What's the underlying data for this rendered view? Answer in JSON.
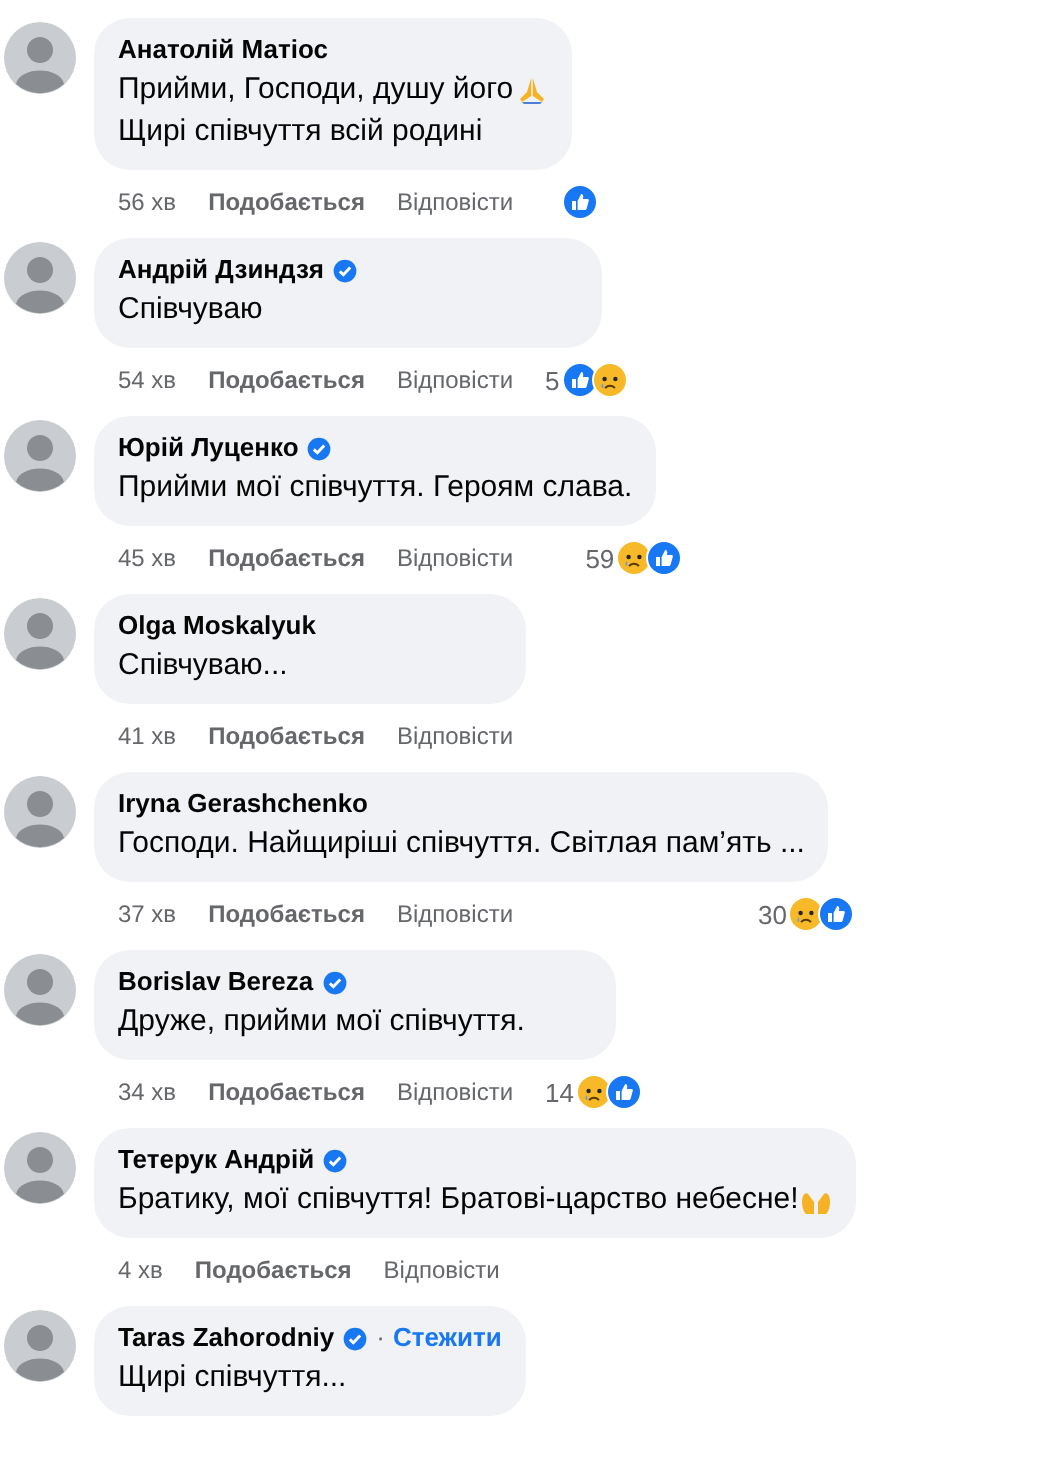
{
  "comments": [
    {
      "name": "Анатолій Матіос",
      "verified": false,
      "lines": [
        {
          "text": "Прийми, Господи, душу його",
          "emoji": {
            "kind": "pray"
          }
        },
        {
          "text": "Щирі співчуття всій родині"
        }
      ],
      "time": "56 хв",
      "like": "Подобається",
      "reply": "Відповісти",
      "reactions": [
        {
          "kind": "like"
        }
      ]
    },
    {
      "name": "Андрій Дзиндзя",
      "verified": true,
      "lines": [
        {
          "text": "Співчуваю"
        }
      ],
      "time": "54 хв",
      "like": "Подобається",
      "reply": "Відповісти",
      "count": "5",
      "reactions": [
        {
          "kind": "like"
        },
        {
          "kind": "sad"
        }
      ]
    },
    {
      "name": "Юрій Луценко",
      "verified": true,
      "lines": [
        {
          "text": "Прийми мої співчуття. Героям слава."
        }
      ],
      "time": "45 хв",
      "like": "Подобається",
      "reply": "Відповісти",
      "count": "59",
      "reactions": [
        {
          "kind": "sad"
        },
        {
          "kind": "like"
        }
      ]
    },
    {
      "name": "Olga Moskalyuk",
      "verified": false,
      "lines": [
        {
          "text": "Співчуваю..."
        }
      ],
      "time": "41 хв",
      "like": "Подобається",
      "reply": "Відповісти"
    },
    {
      "name": "Iryna Gerashchenko",
      "verified": false,
      "lines": [
        {
          "text": "Господи. Найщиріші співчуття. Світлая пам’ять ..."
        }
      ],
      "time": "37 хв",
      "like": "Подобається",
      "reply": "Відповісти",
      "count": "30",
      "reactions": [
        {
          "kind": "sad"
        },
        {
          "kind": "like"
        }
      ]
    },
    {
      "name": "Borislav Bereza",
      "verified": true,
      "lines": [
        {
          "text": "Друже, прийми мої співчуття."
        }
      ],
      "time": "34 хв",
      "like": "Подобається",
      "reply": "Відповісти",
      "count": "14",
      "reactions": [
        {
          "kind": "sad"
        },
        {
          "kind": "like"
        }
      ]
    },
    {
      "name": "Тетерук Андрій",
      "verified": true,
      "lines": [
        {
          "text": "Братику, мої співчуття! Братові-царство небесне!",
          "emoji": {
            "kind": "raised-hands"
          }
        }
      ],
      "time": "4 хв",
      "like": "Подобається",
      "reply": "Відповісти"
    },
    {
      "name": "Taras Zahorodniy",
      "verified": true,
      "follow_separator": "·",
      "follow": "Стежити",
      "lines": [
        {
          "text": "Щирі співчуття..."
        }
      ]
    }
  ]
}
